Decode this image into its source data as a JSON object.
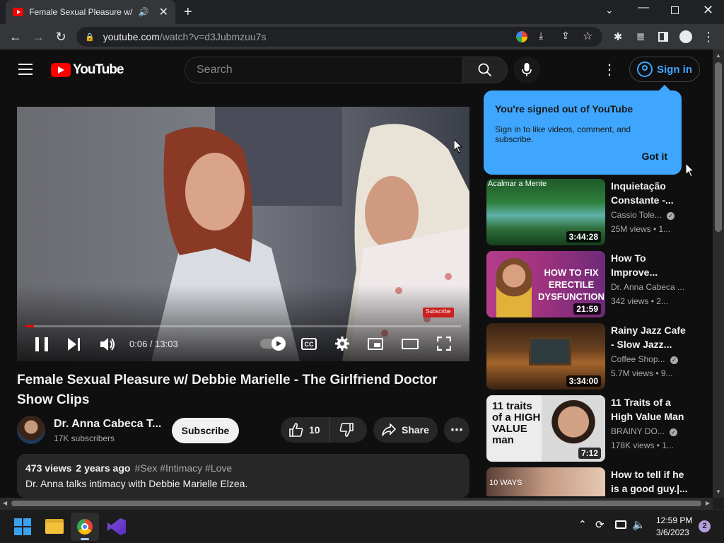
{
  "browser": {
    "tab_title": "Female Sexual Pleasure w/ De",
    "url_domain": "youtube.com",
    "url_path": "/watch?v=d3Jubmzuu7s"
  },
  "youtube": {
    "logo_text": "YouTube",
    "search_placeholder": "Search",
    "signin_label": "Sign in"
  },
  "tooltip": {
    "title": "You're signed out of YouTube",
    "body": "Sign in to like videos, comment, and subscribe.",
    "button": "Got it"
  },
  "player": {
    "time": "0:06 / 13:03",
    "progress": 0.0077,
    "watermark": "Subscribe"
  },
  "video": {
    "title": "Female Sexual Pleasure w/ Debbie Marielle - The Girlfriend Doctor Show Clips",
    "channel": "Dr. Anna Cabeca T...",
    "subscribers": "17K subscribers",
    "subscribe_label": "Subscribe",
    "likes": "10",
    "share_label": "Share",
    "views": "473 views",
    "age": "2 years ago",
    "tags": "#Sex #Intimacy #Love",
    "description": "Dr. Anna talks intimacy with Debbie Marielle Elzea."
  },
  "recommendations": [
    {
      "title": "Inquietação Constante -...",
      "channel": "Cassio Tole...",
      "verified": true,
      "meta": "25M views • 1...",
      "duration": "3:44:28",
      "thumb_label": "Acalmar a Mente"
    },
    {
      "title": "How To Improve...",
      "channel": "Dr. Anna Cabeca ...",
      "verified": false,
      "meta": "342 views • 2...",
      "duration": "21:59",
      "thumb_label": "HOW TO FIX ERECTILE DYSFUNCTION"
    },
    {
      "title": "Rainy Jazz Cafe - Slow Jazz...",
      "channel": "Coffee Shop...",
      "verified": true,
      "meta": "5.7M views • 9...",
      "duration": "3:34:00",
      "thumb_label": ""
    },
    {
      "title": "11 Traits of a High Value Man",
      "channel": "BRAINY DO...",
      "verified": true,
      "meta": "178K views • 1...",
      "duration": "7:12",
      "thumb_label": "11 traits of a HIGH VALUE man"
    },
    {
      "title": "How to tell if he is a good guy.|...",
      "channel": "",
      "verified": false,
      "meta": "",
      "duration": "",
      "thumb_label": "10 WAYS"
    }
  ],
  "taskbar": {
    "time": "12:59 PM",
    "date": "3/6/2023",
    "notification_count": "2"
  },
  "colors": {
    "accent": "#3ea6ff",
    "brand_red": "#ff0000",
    "background": "#0f0f0f"
  }
}
